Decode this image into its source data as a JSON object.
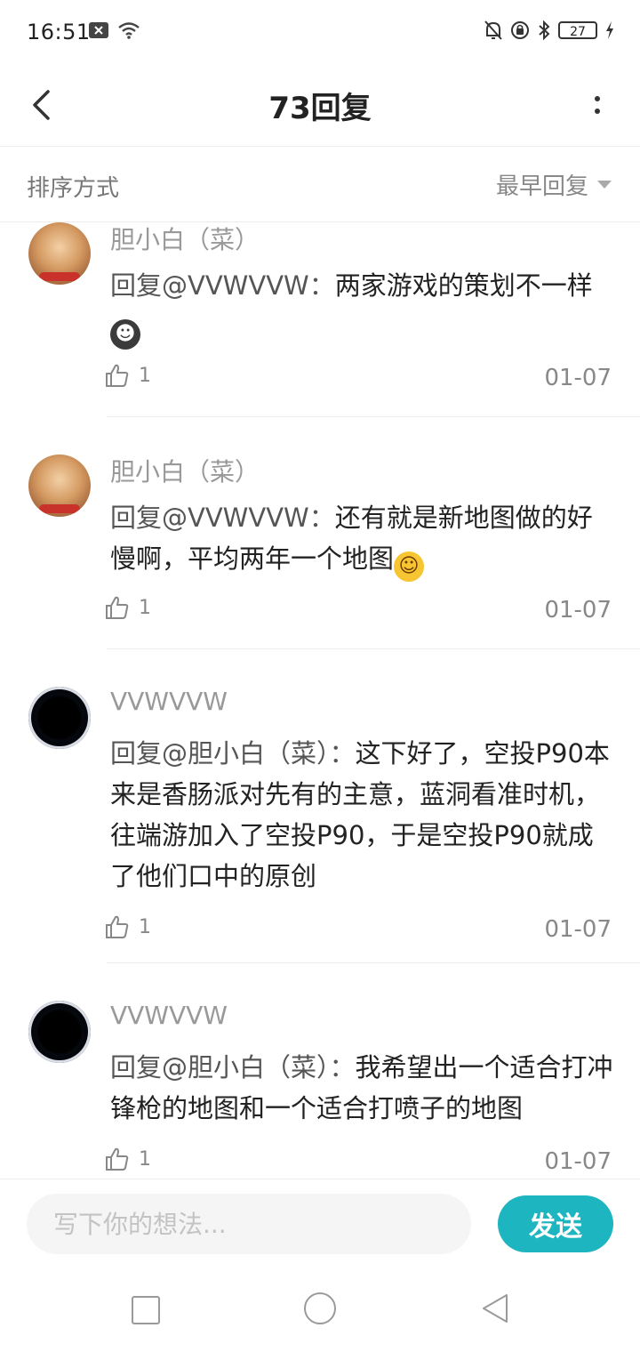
{
  "status_bar": {
    "time": "16:51",
    "battery_level": "27",
    "icons": [
      "close-box-icon",
      "wifi-icon",
      "bell-off-icon",
      "alarm-icon",
      "bluetooth-icon",
      "battery-icon",
      "charging-icon"
    ]
  },
  "header": {
    "title": "73回复",
    "back_icon": "chevron-left-icon",
    "more_icon": "more-vertical-icon"
  },
  "sort": {
    "label": "排序方式",
    "selected": "最早回复"
  },
  "comments": [
    {
      "name": "胆小白（菜）",
      "avatar": "cat-avatar",
      "reply_prefix": "回复@VVWVVW：",
      "text": "两家游戏的策划不一样",
      "emoji": "smile",
      "likes": "1",
      "date": "01-07"
    },
    {
      "name": "胆小白（菜）",
      "avatar": "cat-avatar",
      "reply_prefix": "回复@VVWVVW：",
      "text": "还有就是新地图做的好慢啊，平均两年一个地图",
      "emoji": "sweat-smile",
      "likes": "1",
      "date": "01-07"
    },
    {
      "name": "VVWVVW",
      "avatar": "dark-avatar",
      "reply_prefix": "回复@胆小白（菜）：",
      "text": "这下好了，空投P90本来是香肠派对先有的主意，蓝洞看准时机，往端游加入了空投P90，于是空投P90就成了他们口中的原创",
      "likes": "1",
      "date": "01-07"
    },
    {
      "name": "VVWVVW",
      "avatar": "dark-avatar",
      "reply_prefix": "回复@胆小白（菜）：",
      "text": "我希望出一个适合打冲锋枪的地图和一个适合打喷子的地图",
      "likes": "1",
      "date": "01-07"
    }
  ],
  "input": {
    "placeholder": "写下你的想法...",
    "send_label": "发送"
  },
  "colors": {
    "accent": "#1db5bf",
    "text_primary": "#222222",
    "text_secondary": "#888888",
    "divider": "#ececec"
  }
}
